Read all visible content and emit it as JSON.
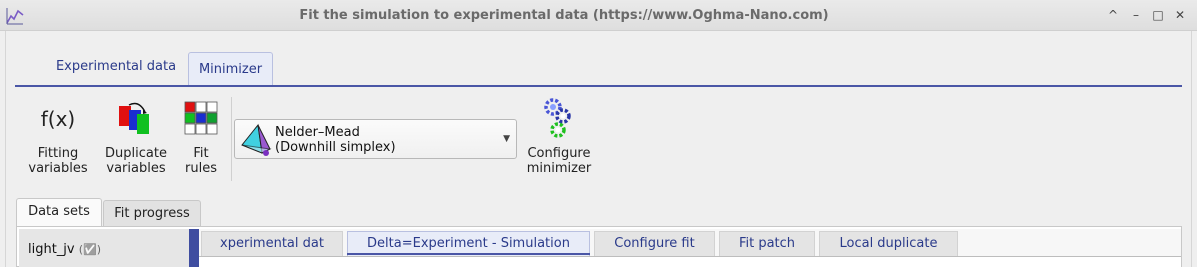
{
  "window": {
    "title": "Fit the simulation to experimental data (https://www.Oghma-Nano.com)",
    "controls": [
      "^",
      "–",
      "□",
      "✕"
    ]
  },
  "top_tabs": [
    {
      "label": "Experimental data",
      "active": false
    },
    {
      "label": "Minimizer",
      "active": true
    }
  ],
  "toolbar": {
    "fitting_variables": {
      "icon_text": "f(x)",
      "line1": "Fitting",
      "line2": "variables"
    },
    "duplicate_variables": {
      "line1": "Duplicate",
      "line2": "variables"
    },
    "fit_rules": {
      "line1": "Fit",
      "line2": "rules"
    },
    "method_combo": {
      "line1": "Nelder–Mead",
      "line2": "(Downhill simplex)"
    },
    "configure_minimizer": {
      "line1": "Configure",
      "line2": "minimizer"
    }
  },
  "lower_tabs": [
    {
      "label": "Data sets",
      "active": true
    },
    {
      "label": "Fit progress",
      "active": false
    }
  ],
  "datasets": [
    {
      "label": "light_jv",
      "check": "(✅)"
    }
  ],
  "inner_tabs": [
    {
      "label": "xperimental dat",
      "active": false
    },
    {
      "label": "Delta=Experiment - Simulation",
      "active": true
    },
    {
      "label": "Configure fit",
      "active": false
    },
    {
      "label": "Fit patch",
      "active": false
    },
    {
      "label": "Local duplicate",
      "active": false
    }
  ],
  "colors": {
    "accent": "#4a56a6",
    "tab_text": "#2a3a8a"
  }
}
